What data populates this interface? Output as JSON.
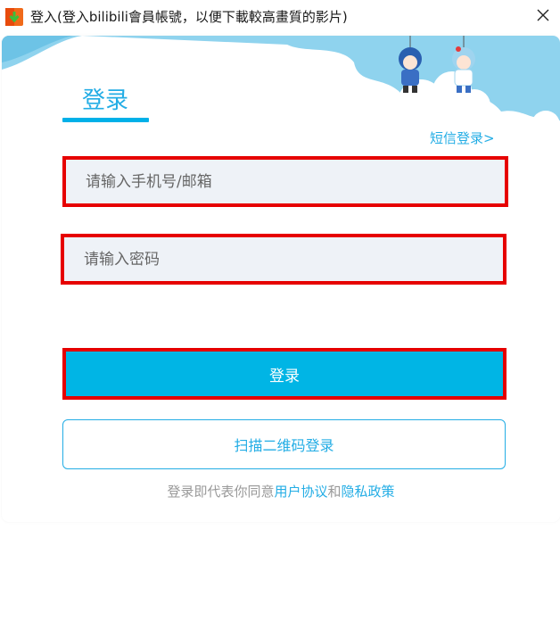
{
  "window": {
    "title": "登入(登入bilibili會員帳號，以便下載較高畫質的影片)",
    "close_glyph": "✕"
  },
  "login": {
    "tab_label": "登录",
    "sms_link": "短信登录>",
    "username_placeholder": "请输入手机号/邮箱",
    "password_placeholder": "请输入密码",
    "login_button": "登录",
    "qr_button": "扫描二维码登录",
    "agreement_prefix": "登录即代表你同意",
    "user_agreement": "用户协议",
    "and_text": "和",
    "privacy_policy": "隐私政策"
  },
  "icons": {
    "app": "download-arrow-icon",
    "close": "close-icon"
  },
  "colors": {
    "accent": "#00b5e5",
    "link": "#23ade5",
    "highlight": "#e60000",
    "input_bg": "#eef2f7",
    "sky": "#8fd3ee"
  }
}
